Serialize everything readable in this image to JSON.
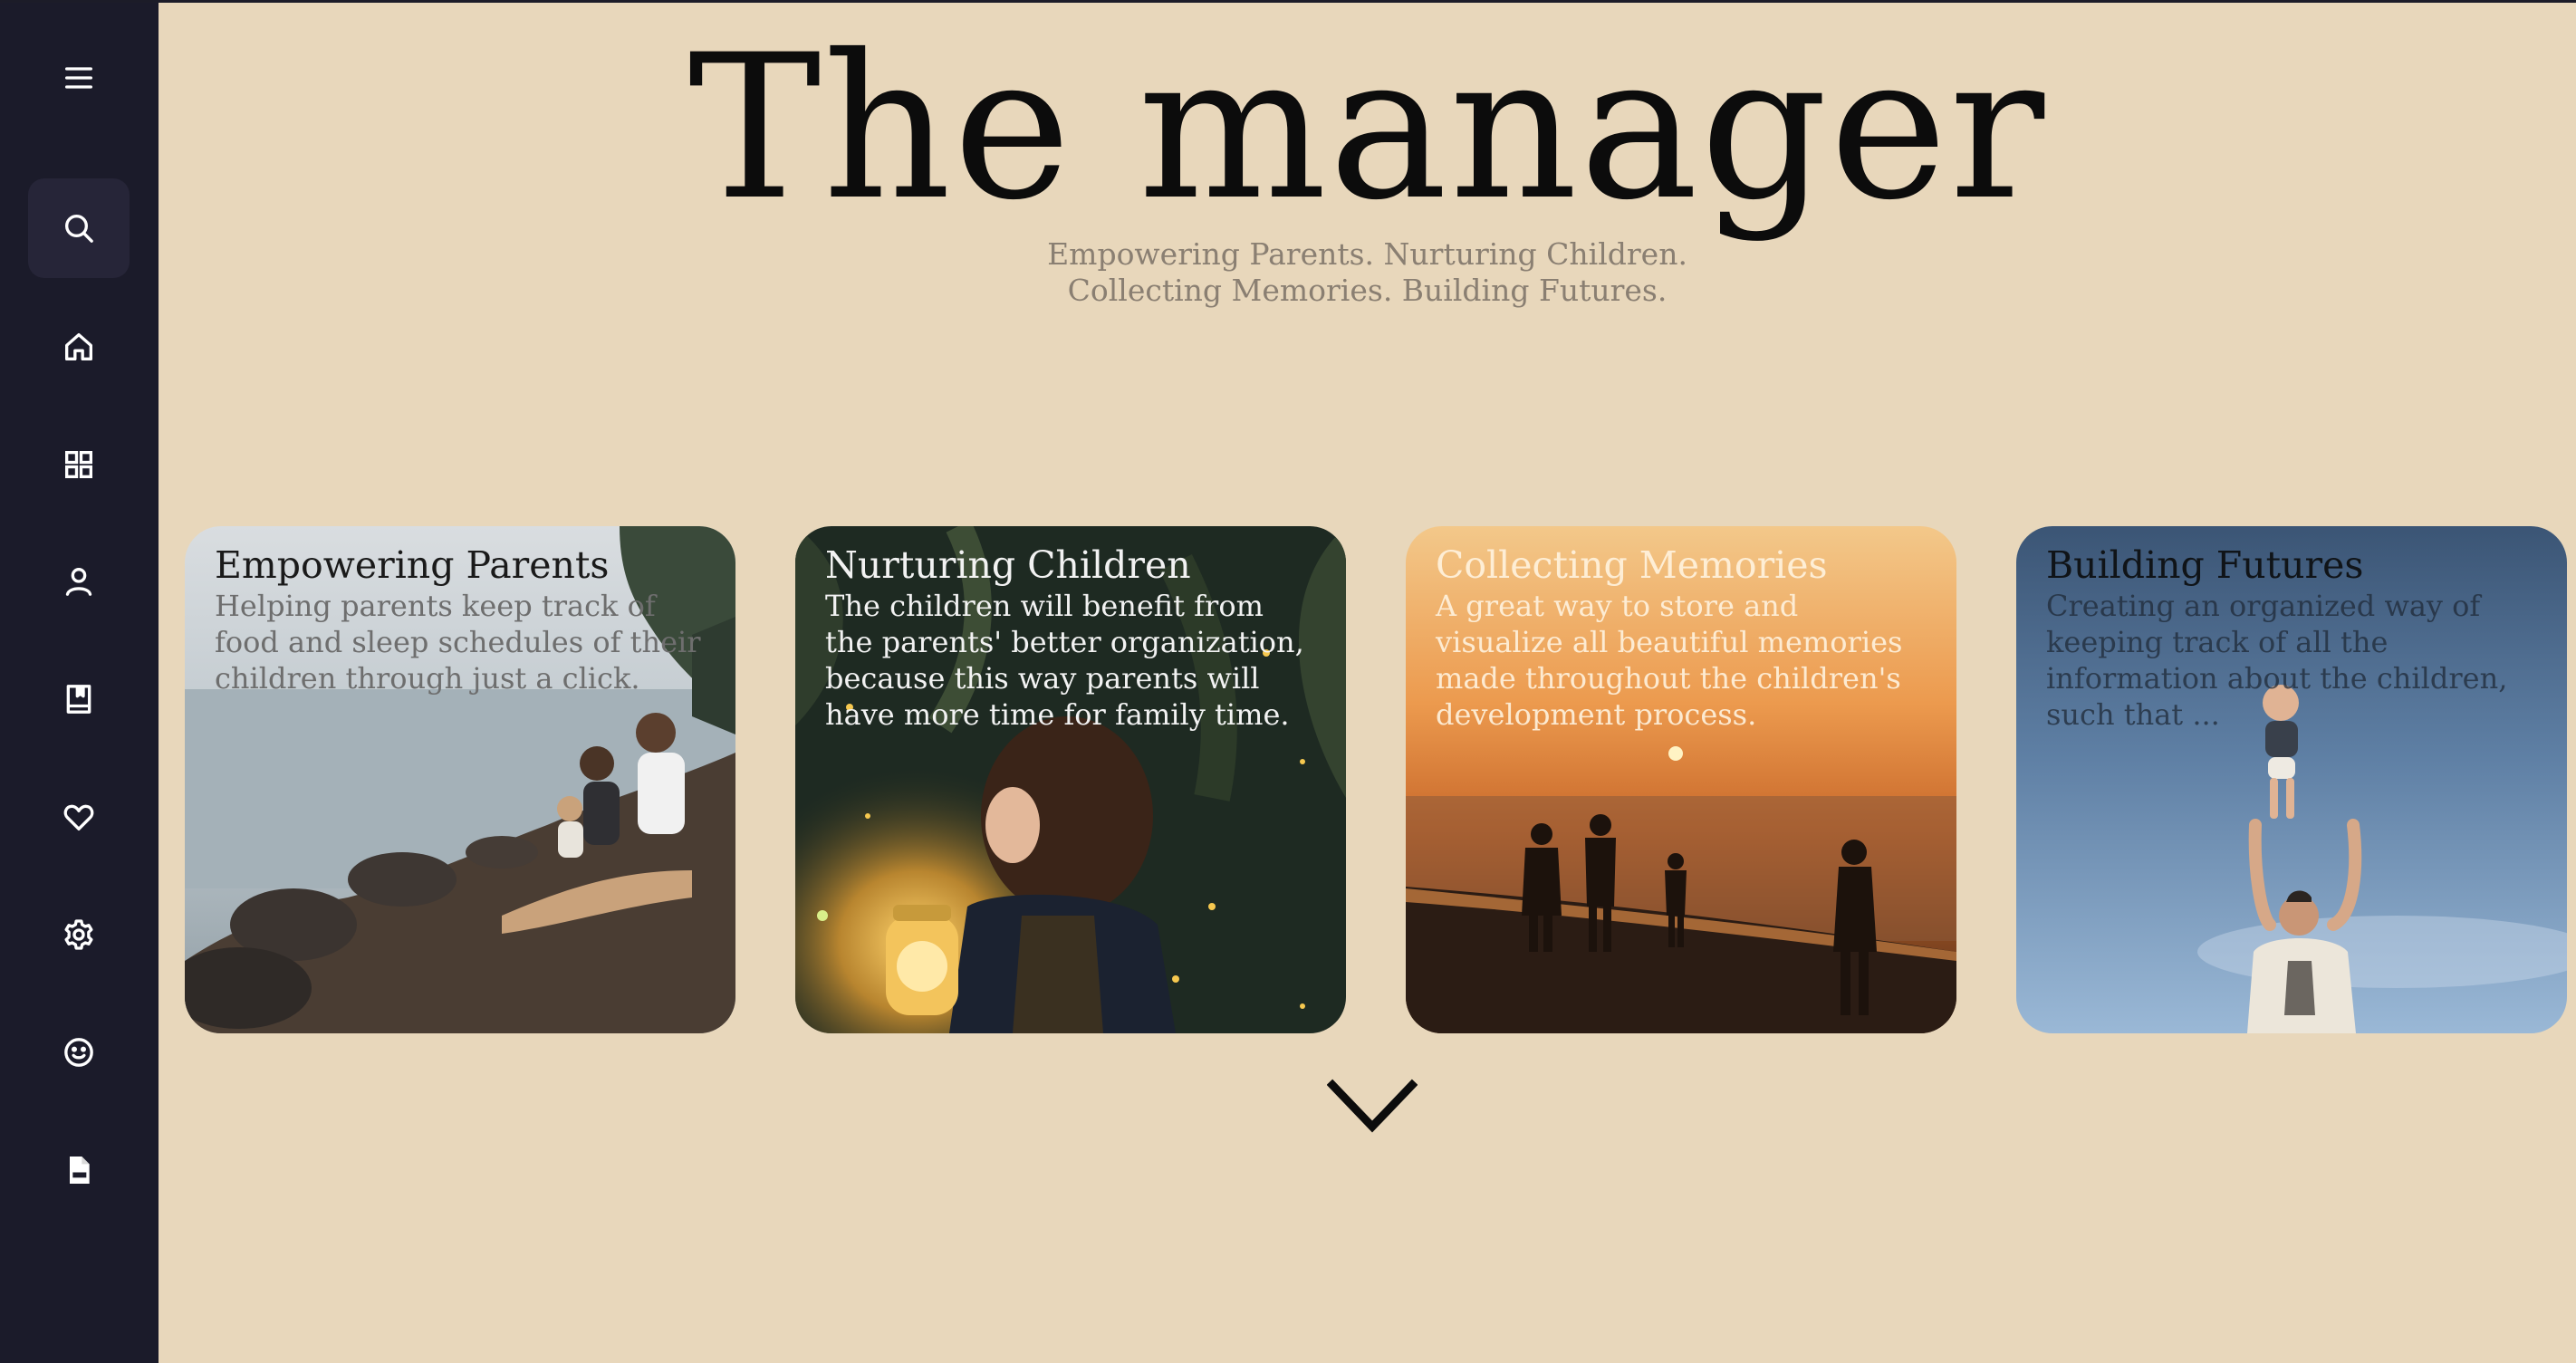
{
  "sidebar": {
    "items": [
      {
        "name": "menu",
        "icon": "hamburger-menu-icon"
      },
      {
        "name": "search",
        "icon": "search-icon",
        "active": true
      },
      {
        "name": "home",
        "icon": "home-icon"
      },
      {
        "name": "dashboard",
        "icon": "grid-icon"
      },
      {
        "name": "profile",
        "icon": "user-icon"
      },
      {
        "name": "journal",
        "icon": "book-icon"
      },
      {
        "name": "favorites",
        "icon": "heart-icon"
      },
      {
        "name": "settings",
        "icon": "gear-icon"
      },
      {
        "name": "mood",
        "icon": "smiley-icon"
      },
      {
        "name": "documents",
        "icon": "document-icon"
      }
    ],
    "colors": {
      "background": "#1b1b2a",
      "icon": "#ffffff",
      "active": "#262538"
    }
  },
  "hero": {
    "title": "The manager",
    "subtitle_line1": "Empowering Parents. Nurturing Children.",
    "subtitle_line2": "Collecting Memories. Building Futures."
  },
  "cards": [
    {
      "title": "Empowering Parents",
      "description": "Helping parents keep track of food and sleep schedules of their children through just a click."
    },
    {
      "title": "Nurturing Children",
      "description": "The children will benefit from the parents' better organization, because this way parents will have more time for family time."
    },
    {
      "title": "Collecting Memories",
      "description": "A great way to store and visualize all beautiful memories made throughout the children's development process."
    },
    {
      "title": "Building Futures",
      "description": "Creating an organized way of keeping track of all the information about the children, such that ..."
    }
  ],
  "scroll_icon": "chevron-down-icon",
  "theme": {
    "page_background": "#e8d7bb",
    "title_color": "#0c0c0c",
    "subtitle_color": "#8a7f72"
  }
}
